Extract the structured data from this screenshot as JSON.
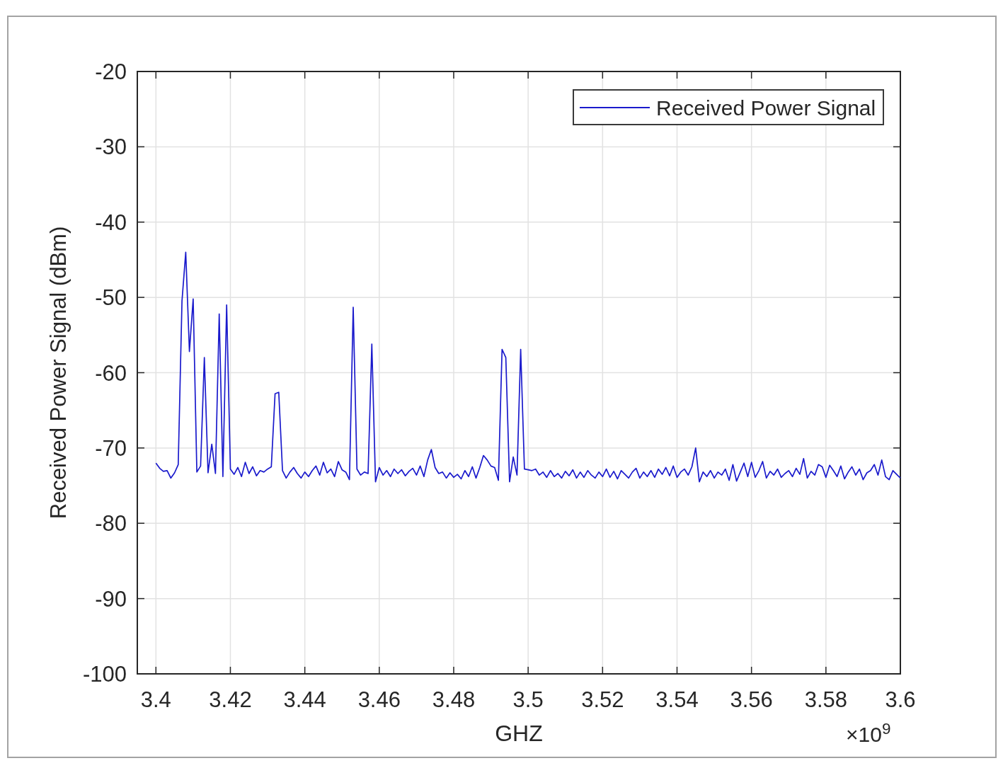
{
  "figure": {
    "chart_data": {
      "type": "line",
      "xlabel": "GHZ",
      "ylabel": "Received Power Signal (dBm)",
      "grid": true,
      "x": [
        3.4,
        3.401,
        3.402,
        3.403,
        3.404,
        3.405,
        3.406,
        3.407,
        3.408,
        3.409,
        3.41,
        3.411,
        3.412,
        3.413,
        3.414,
        3.415,
        3.416,
        3.417,
        3.418,
        3.419,
        3.42,
        3.421,
        3.422,
        3.423,
        3.424,
        3.425,
        3.426,
        3.427,
        3.428,
        3.429,
        3.43,
        3.431,
        3.432,
        3.433,
        3.434,
        3.435,
        3.436,
        3.437,
        3.438,
        3.439,
        3.44,
        3.441,
        3.442,
        3.443,
        3.444,
        3.445,
        3.446,
        3.447,
        3.448,
        3.449,
        3.45,
        3.451,
        3.452,
        3.453,
        3.454,
        3.455,
        3.456,
        3.457,
        3.458,
        3.459,
        3.46,
        3.461,
        3.462,
        3.463,
        3.464,
        3.465,
        3.466,
        3.467,
        3.468,
        3.469,
        3.47,
        3.471,
        3.472,
        3.473,
        3.474,
        3.475,
        3.476,
        3.477,
        3.478,
        3.479,
        3.48,
        3.481,
        3.482,
        3.483,
        3.484,
        3.485,
        3.486,
        3.487,
        3.488,
        3.489,
        3.49,
        3.491,
        3.492,
        3.493,
        3.494,
        3.495,
        3.496,
        3.497,
        3.498,
        3.499,
        3.5,
        3.501,
        3.502,
        3.503,
        3.504,
        3.505,
        3.506,
        3.507,
        3.508,
        3.509,
        3.51,
        3.511,
        3.512,
        3.513,
        3.514,
        3.515,
        3.516,
        3.517,
        3.518,
        3.519,
        3.52,
        3.521,
        3.522,
        3.523,
        3.524,
        3.525,
        3.526,
        3.527,
        3.528,
        3.529,
        3.53,
        3.531,
        3.532,
        3.533,
        3.534,
        3.535,
        3.536,
        3.537,
        3.538,
        3.539,
        3.54,
        3.541,
        3.542,
        3.543,
        3.544,
        3.545,
        3.546,
        3.547,
        3.548,
        3.549,
        3.55,
        3.551,
        3.552,
        3.553,
        3.554,
        3.555,
        3.556,
        3.557,
        3.558,
        3.559,
        3.56,
        3.561,
        3.562,
        3.563,
        3.564,
        3.565,
        3.566,
        3.567,
        3.568,
        3.569,
        3.57,
        3.571,
        3.572,
        3.573,
        3.574,
        3.575,
        3.576,
        3.577,
        3.578,
        3.579,
        3.58,
        3.581,
        3.582,
        3.583,
        3.584,
        3.585,
        3.586,
        3.587,
        3.588,
        3.589,
        3.59,
        3.591,
        3.592,
        3.593,
        3.594,
        3.595,
        3.596,
        3.597,
        3.598,
        3.599,
        3.6
      ],
      "series": [
        {
          "name": "Received Power Signal",
          "color": "#1a1acc",
          "values": [
            -72.0,
            -72.7,
            -73.1,
            -73.0,
            -74.0,
            -73.3,
            -72.2,
            -50.5,
            -44.0,
            -57.2,
            -50.2,
            -73.2,
            -72.4,
            -58.0,
            -73.3,
            -69.5,
            -73.4,
            -52.2,
            -73.8,
            -51.0,
            -72.8,
            -73.5,
            -72.6,
            -73.8,
            -71.9,
            -73.4,
            -72.5,
            -73.7,
            -73.0,
            -73.2,
            -72.8,
            -72.5,
            -62.8,
            -62.6,
            -73.0,
            -74.0,
            -73.2,
            -72.6,
            -73.4,
            -74.0,
            -73.2,
            -73.8,
            -73.0,
            -72.4,
            -73.6,
            -71.9,
            -73.3,
            -72.8,
            -73.8,
            -71.8,
            -72.9,
            -73.2,
            -74.2,
            -51.3,
            -72.8,
            -73.6,
            -73.2,
            -73.4,
            -56.2,
            -74.5,
            -72.6,
            -73.6,
            -73.0,
            -73.8,
            -72.8,
            -73.4,
            -72.9,
            -73.7,
            -73.1,
            -72.7,
            -73.6,
            -72.4,
            -73.8,
            -71.6,
            -70.2,
            -72.6,
            -73.4,
            -73.2,
            -74.0,
            -73.3,
            -73.9,
            -73.5,
            -74.1,
            -73.0,
            -73.8,
            -72.5,
            -74.0,
            -72.6,
            -71.0,
            -71.6,
            -72.4,
            -72.6,
            -74.3,
            -56.9,
            -58.0,
            -74.5,
            -71.2,
            -73.6,
            -56.9,
            -72.8,
            -72.9,
            -73.0,
            -72.8,
            -73.6,
            -73.2,
            -73.9,
            -73.0,
            -73.8,
            -73.4,
            -74.0,
            -73.1,
            -73.7,
            -72.9,
            -74.0,
            -73.2,
            -73.9,
            -73.0,
            -73.6,
            -74.0,
            -73.2,
            -73.8,
            -72.8,
            -73.9,
            -73.1,
            -74.1,
            -73.0,
            -73.5,
            -74.0,
            -73.2,
            -72.7,
            -74.0,
            -73.2,
            -73.8,
            -73.0,
            -73.9,
            -72.8,
            -73.5,
            -72.6,
            -73.7,
            -72.4,
            -73.9,
            -73.2,
            -72.8,
            -73.6,
            -72.5,
            -70.0,
            -74.5,
            -73.2,
            -73.8,
            -73.0,
            -74.0,
            -73.2,
            -73.6,
            -72.8,
            -74.3,
            -72.2,
            -74.4,
            -73.2,
            -72.0,
            -73.8,
            -71.9,
            -73.9,
            -73.0,
            -71.8,
            -74.0,
            -73.1,
            -73.6,
            -72.8,
            -73.9,
            -73.4,
            -73.0,
            -73.8,
            -72.7,
            -73.5,
            -71.4,
            -74.0,
            -73.1,
            -73.6,
            -72.2,
            -72.5,
            -73.9,
            -72.3,
            -73.0,
            -73.8,
            -72.4,
            -74.1,
            -73.2,
            -72.5,
            -73.6,
            -72.8,
            -74.2,
            -73.3,
            -73.0,
            -72.2,
            -73.6,
            -71.6,
            -73.8,
            -74.2,
            -73.0,
            -73.5,
            -74.0
          ]
        }
      ],
      "xlim": [
        3.395,
        3.6
      ],
      "ylim": [
        -100,
        -20
      ],
      "xticks": [
        3.4,
        3.42,
        3.44,
        3.46,
        3.48,
        3.5,
        3.52,
        3.54,
        3.56,
        3.58,
        3.6
      ],
      "yticks": [
        -100,
        -90,
        -80,
        -70,
        -60,
        -50,
        -40,
        -30,
        -20
      ]
    },
    "x_exponent": "×10$^{9}$"
  }
}
